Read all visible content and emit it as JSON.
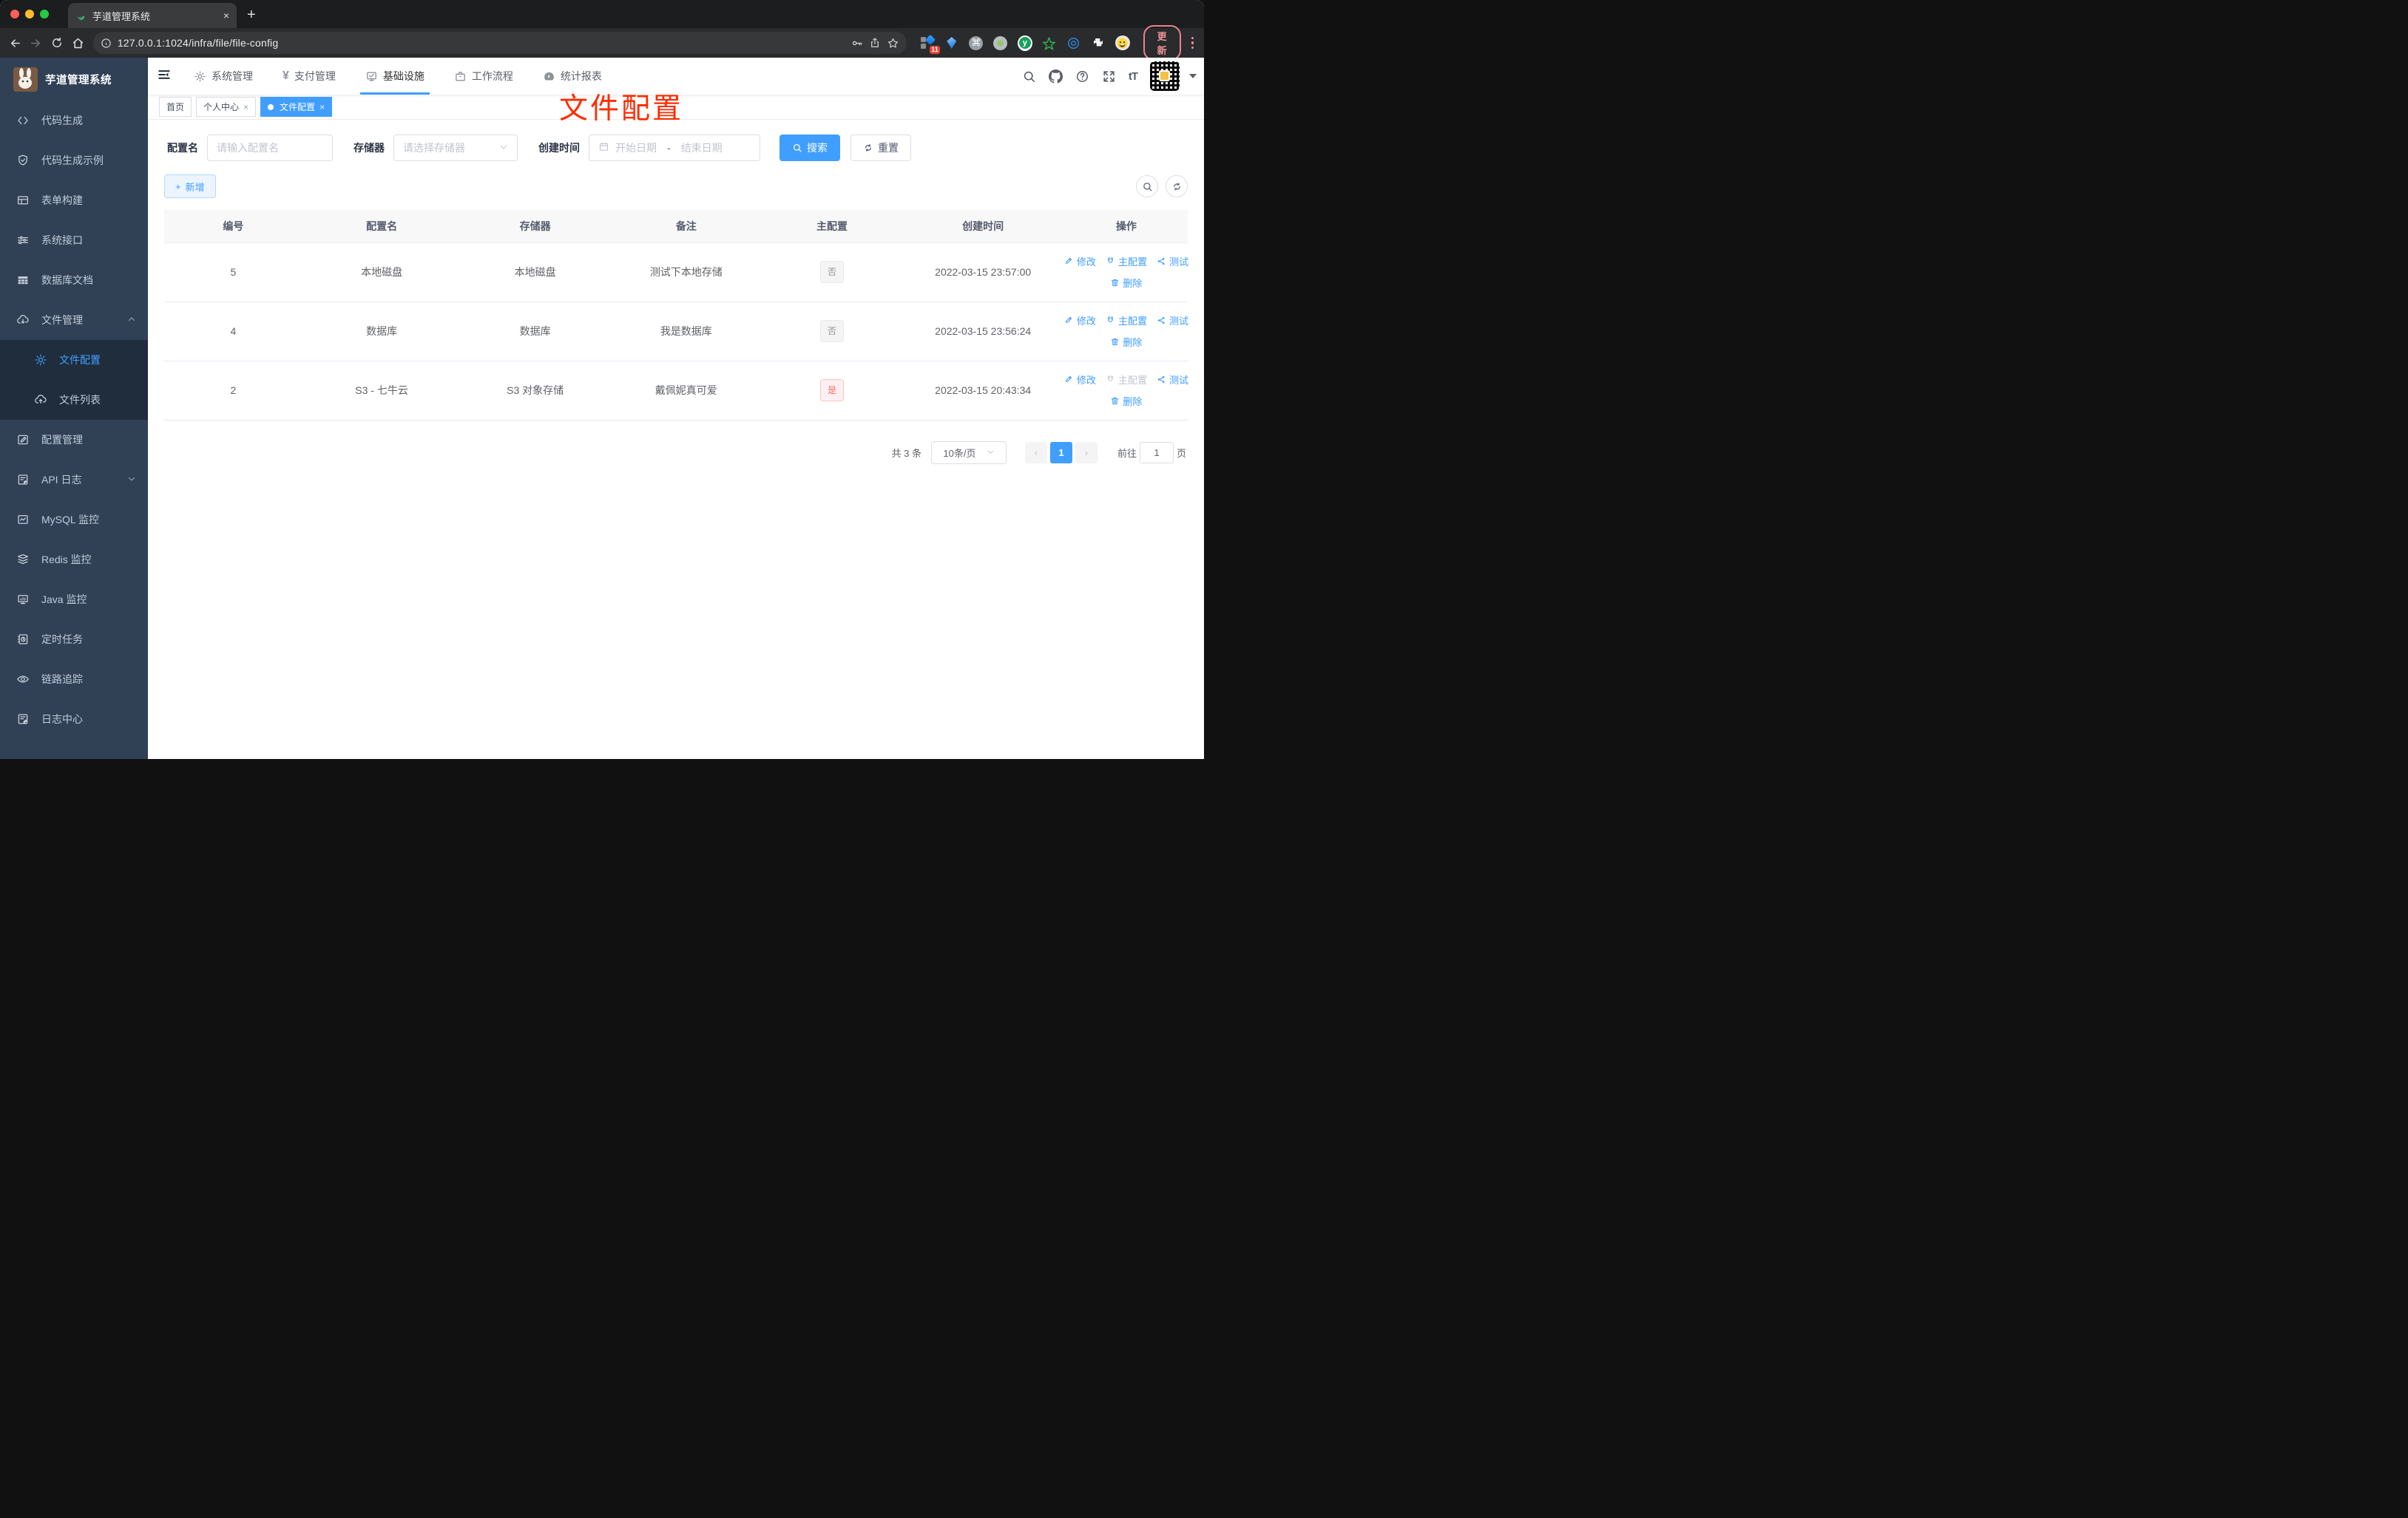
{
  "colors": {
    "accent": "#409eff",
    "sidebar_bg": "#304156",
    "submenu_bg": "#1f2d3d",
    "danger": "#f56c6c",
    "annotation_red": "#fe2c00"
  },
  "browser": {
    "tab_title": "芋道管理系统",
    "tab_close": "×",
    "new_tab": "+",
    "url": "127.0.0.1:1024/infra/file/file-config",
    "extension_badge": "11",
    "ext_cmd_symbol": "⌘",
    "ext_y_letter": "y",
    "update_button": "更新"
  },
  "icons": {
    "favicon": "sprout-icon",
    "left_nav": [
      "back-icon",
      "forward-icon",
      "reload-icon",
      "home-icon"
    ],
    "url_right": [
      "key-icon",
      "share-icon",
      "star-icon"
    ],
    "nav_right": [
      "search-icon",
      "github-icon",
      "help-icon",
      "fullscreen-icon",
      "font-size-icon",
      "avatar-qr",
      "caret-down-icon"
    ]
  },
  "sidebar": {
    "title": "芋道管理系统",
    "items": [
      {
        "label": "代码生成"
      },
      {
        "label": "代码生成示例"
      },
      {
        "label": "表单构建"
      },
      {
        "label": "系统接口"
      },
      {
        "label": "数据库文档"
      },
      {
        "label": "文件管理"
      },
      {
        "label": "文件配置"
      },
      {
        "label": "文件列表"
      },
      {
        "label": "配置管理"
      },
      {
        "label": "API 日志"
      },
      {
        "label": "MySQL 监控"
      },
      {
        "label": "Redis 监控"
      },
      {
        "label": "Java 监控"
      },
      {
        "label": "定时任务"
      },
      {
        "label": "链路追踪"
      },
      {
        "label": "日志中心"
      }
    ]
  },
  "topnav": {
    "menus": [
      {
        "label": "系统管理"
      },
      {
        "label": "支付管理"
      },
      {
        "label": "基础设施"
      },
      {
        "label": "工作流程"
      },
      {
        "label": "统计报表"
      }
    ],
    "yen": "¥",
    "font_size_glyph": "tT"
  },
  "tags": {
    "home": "首页",
    "profile": "个人中心",
    "file_config": "文件配置",
    "close": "×"
  },
  "annotation": "文件配置",
  "filters": {
    "name_label": "配置名",
    "name_placeholder": "请输入配置名",
    "storage_label": "存储器",
    "storage_placeholder": "请选择存储器",
    "date_label": "创建时间",
    "date_start": "开始日期",
    "date_sep": "-",
    "date_end": "结束日期",
    "search": "搜索",
    "reset": "重置"
  },
  "toolbar": {
    "add": "新增",
    "add_plus": "+"
  },
  "table": {
    "headers": [
      "编号",
      "配置名",
      "存储器",
      "备注",
      "主配置",
      "创建时间",
      "操作"
    ],
    "actions": {
      "edit": "修改",
      "master": "主配置",
      "test": "测试",
      "delete": "删除"
    },
    "rows": [
      {
        "id": "5",
        "name": "本地磁盘",
        "storage": "本地磁盘",
        "remark": "测试下本地存储",
        "master": "否",
        "time": "2022-03-15 23:57:00"
      },
      {
        "id": "4",
        "name": "数据库",
        "storage": "数据库",
        "remark": "我是数据库",
        "master": "否",
        "time": "2022-03-15 23:56:24"
      },
      {
        "id": "2",
        "name": "S3 - 七牛云",
        "storage": "S3 对象存储",
        "remark": "戴佩妮真可爱",
        "master": "是",
        "time": "2022-03-15 20:43:34"
      }
    ]
  },
  "pagination": {
    "total": "共 3 条",
    "page_size": "10条/页",
    "prev": "‹",
    "page": "1",
    "next": "›",
    "goto": "前往",
    "goto_value": "1",
    "page_unit": "页"
  }
}
